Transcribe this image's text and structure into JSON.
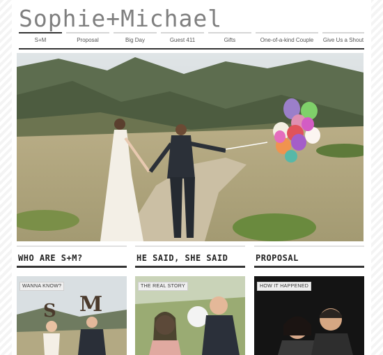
{
  "site": {
    "title": "Sophie+Michael"
  },
  "nav": {
    "items": [
      {
        "label": "S+M"
      },
      {
        "label": "Proposal"
      },
      {
        "label": "Big Day"
      },
      {
        "label": "Guest 411"
      },
      {
        "label": "Gifts"
      },
      {
        "label": "One-of-a-kind Couple"
      },
      {
        "label": "Give Us a Shout"
      }
    ]
  },
  "sections": [
    {
      "heading": "WHO ARE S+M?",
      "badge": "WANNA KNOW?"
    },
    {
      "heading": "HE SAID, SHE SAID",
      "badge": "THE REAL STORY"
    },
    {
      "heading": "PROPOSAL",
      "badge": "HOW IT HAPPENED"
    }
  ],
  "colors": {
    "accent_rule": "#333333",
    "title_gray": "#7f7f7f"
  }
}
